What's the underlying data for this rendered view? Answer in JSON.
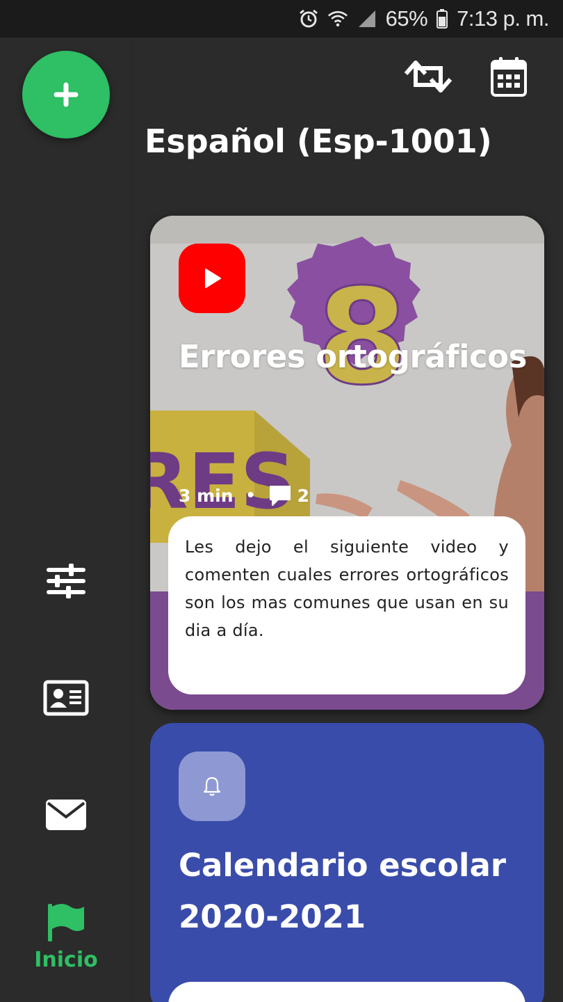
{
  "status_bar": {
    "battery": "65%",
    "time": "7:13 p. m.",
    "icons": [
      "alarm-icon",
      "wifi-icon",
      "signal-icon",
      "battery-icon"
    ]
  },
  "sidebar": {
    "fab_icon": "plus-icon",
    "items": [
      {
        "icon": "sliders-icon",
        "label": ""
      },
      {
        "icon": "contact-card-icon",
        "label": ""
      },
      {
        "icon": "mail-icon",
        "label": ""
      },
      {
        "icon": "flag-icon",
        "label": "Inicio"
      }
    ],
    "active_color": "#2fbf64"
  },
  "header": {
    "actions": [
      "swap-icon",
      "calendar-icon"
    ],
    "title": "Español (Esp-1001)"
  },
  "cards": [
    {
      "type": "video",
      "badge_icon": "youtube-play-icon",
      "title": "Errores ortográficos",
      "duration": "3 min",
      "separator": "•",
      "comment_icon": "comment-icon",
      "comments": "2",
      "description": "Les dejo el siguiente video y comenten cuales errores ortográficos son los mas comunes que usan en su dia a día."
    },
    {
      "type": "notice",
      "badge_icon": "bell-icon",
      "title": "Calendario escolar 2020-2021",
      "color": "#3a4caa"
    }
  ]
}
